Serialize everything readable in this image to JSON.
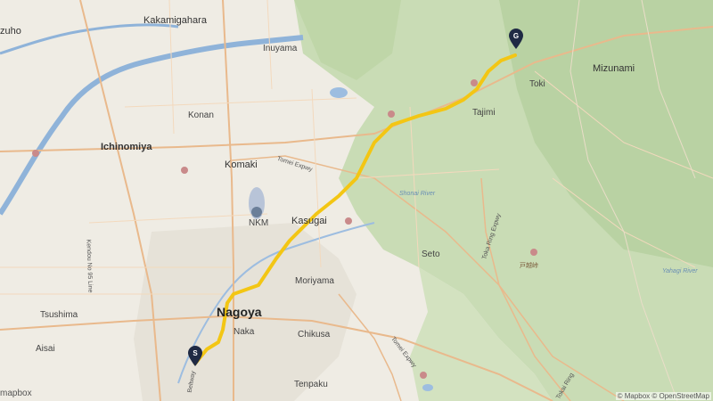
{
  "map": {
    "labels": {
      "mizuho": "zuho",
      "kakamigahara": "Kakamigahara",
      "inuyama": "Inuyama",
      "konan": "Konan",
      "ichinomiya": "Ichinomiya",
      "komaki": "Komaki",
      "tomei_expwy": "Tomei Expwy",
      "nkm": "NKM",
      "kasugai": "Kasugai",
      "moriyama": "Moriyama",
      "seto": "Seto",
      "nagoya": "Nagoya",
      "naka": "Naka",
      "chikusa": "Chikusa",
      "tsushima": "Tsushima",
      "aisai": "Aisai",
      "tenpaku": "Tenpaku",
      "kendou_no_95": "Kendou No 95 Line",
      "beltway": "Beltway",
      "tajimi": "Tajimi",
      "toki": "Toki",
      "mizunami": "Mizunami",
      "toka_ring": "Toka Ring Expwy",
      "tomei_expwy2": "Tomei Expwy",
      "shonai_river": "Shonai River",
      "yahagi_river": "Yahagi River",
      "mountain": "戸越峠",
      "tokai_ring": "Tokai Ring"
    },
    "markers": {
      "start": "S",
      "goal": "G"
    },
    "attribution": "© Mapbox © OpenStreetMap",
    "logo": "mapbox"
  }
}
